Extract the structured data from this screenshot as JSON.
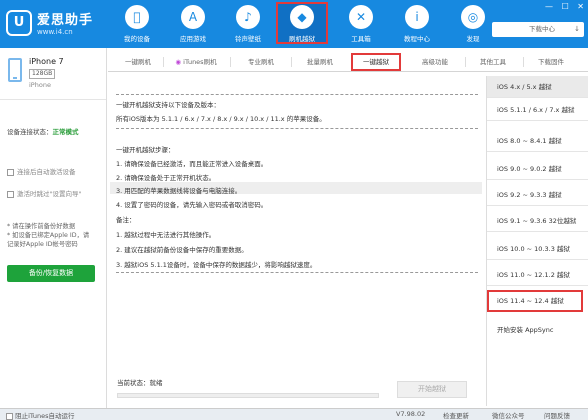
{
  "app": {
    "logo_mark": "U",
    "name": "爱思助手",
    "url": "www.i4.cn"
  },
  "nav": [
    {
      "label": "我的设备",
      "icon": "apple-icon",
      "glyph": ""
    },
    {
      "label": "应用游戏",
      "icon": "app-store-icon",
      "glyph": "A"
    },
    {
      "label": "铃声壁纸",
      "icon": "bell-icon",
      "glyph": "♪"
    },
    {
      "label": "刷机越狱",
      "icon": "dropbox-icon",
      "glyph": "◆"
    },
    {
      "label": "工具箱",
      "icon": "tools-icon",
      "glyph": "✕"
    },
    {
      "label": "教程中心",
      "icon": "info-icon",
      "glyph": "i"
    },
    {
      "label": "发现",
      "icon": "compass-icon",
      "glyph": "◎"
    }
  ],
  "window_controls": {
    "min": "—",
    "max": "☐",
    "close": "✕"
  },
  "download_center": "下载中心",
  "device": {
    "name": "iPhone 7",
    "capacity": "128GB",
    "kind": "iPhone"
  },
  "connection": {
    "label": "设备连接状态：",
    "value": "正常模式"
  },
  "options": [
    {
      "label": "连接后自动激活设备"
    },
    {
      "label": "激活时跳过\"设置向导\""
    }
  ],
  "notes": [
    "* 请在操作前备份好数据",
    "* 如设备已绑定Apple ID，请",
    "记录好Apple ID帐号密码"
  ],
  "backup_button": "备份/恢复数据",
  "tabs": [
    {
      "label": "一键刷机"
    },
    {
      "label": "iTunes刷机"
    },
    {
      "label": "专业刷机"
    },
    {
      "label": "批量刷机"
    },
    {
      "label": "一键越狱"
    },
    {
      "label": "高级功能"
    },
    {
      "label": "其他工具"
    },
    {
      "label": "下载固件"
    }
  ],
  "instructions": [
    "一键开机越狱支持以下设备及版本：",
    "所有iOS版本为 5.1.1 / 6.x / 7.x / 8.x / 9.x / 10.x / 11.x 的苹果设备。",
    "一键开机越狱步骤：",
    "1. 请确保设备已经激活，而且能正常进入设备桌面。",
    "2. 请确保设备处于正常开机状态。",
    "3. 用匹配的苹果数据线将设备与电脑连接。",
    "4. 设置了密码的设备，请先输入密码或者取消密码。",
    "备注：",
    "1. 越狱过程中无法进行其他操作。",
    "2. 建议在越狱前备份设备中保存的重要数据。",
    "3. 越狱iOS 5.1.1设备时，设备中保存的数据越少，将影响越狱速度。"
  ],
  "status": {
    "label": "当前状态：",
    "value": "就绪"
  },
  "progress": 0,
  "start_button": "开始越狱",
  "versions": [
    "iOS 4.x / 5.x 越狱",
    "iOS 5.1.1 / 6.x / 7.x 越狱",
    "iOS 8.0 ~ 8.4.1 越狱",
    "iOS 9.0 ~ 9.0.2 越狱",
    "iOS 9.2 ~ 9.3.3 越狱",
    "iOS 9.1 ~ 9.3.6 32位越狱",
    "iOS 10.0 ~ 10.3.3 越狱",
    "iOS 11.0 ~ 12.1.2 越狱",
    "iOS 11.4 ~ 12.4 越狱",
    "开始安装 AppSync"
  ],
  "bottom": {
    "itunes_autorun": "阻止iTunes自动运行",
    "version": "V7.98.02",
    "check_update": "检查更新",
    "wechat": "微信公众号",
    "feedback": "问题反馈"
  }
}
